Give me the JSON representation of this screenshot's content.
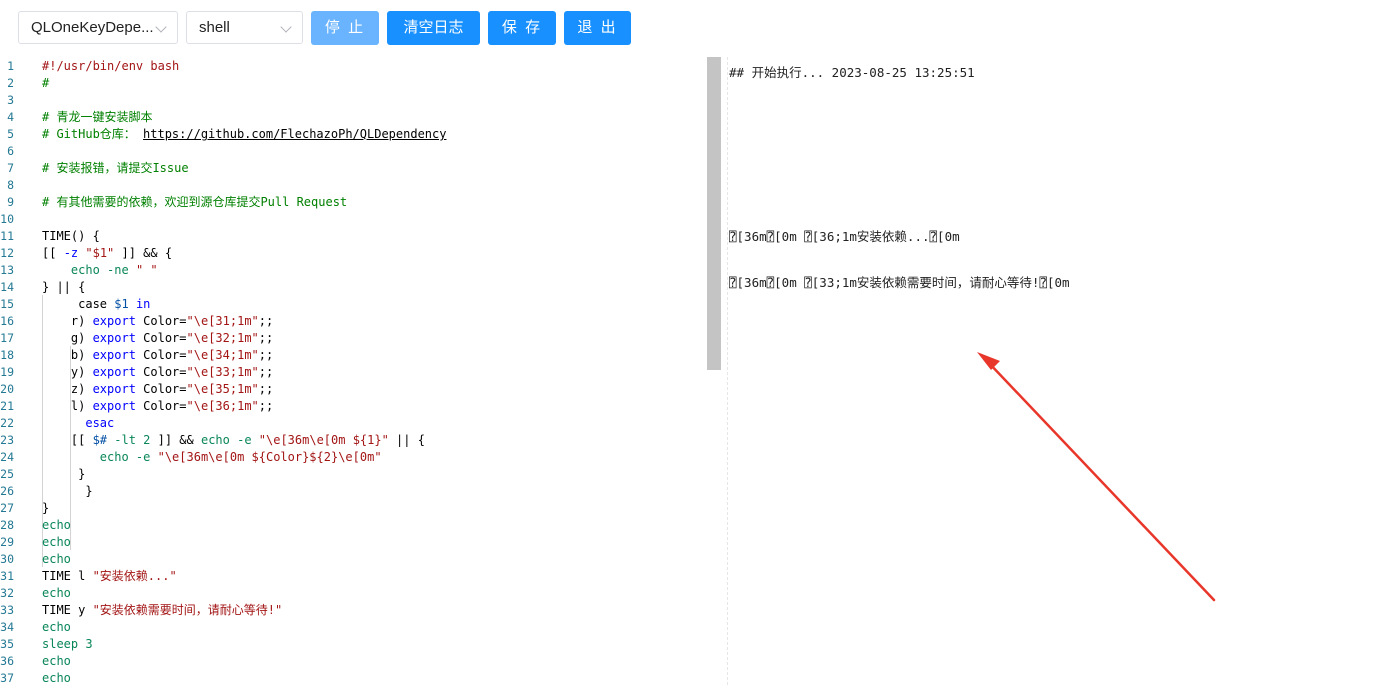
{
  "toolbar": {
    "script_select": "QLOneKeyDepe...",
    "lang_select": "shell",
    "stop_label": "停 止",
    "clear_label": "清空日志",
    "save_label": "保 存",
    "exit_label": "退 出"
  },
  "editor": {
    "lines": [
      {
        "n": "1",
        "parts": [
          {
            "t": "#!/usr/bin/env bash",
            "c": "c-str"
          }
        ]
      },
      {
        "n": "2",
        "parts": [
          {
            "t": "#",
            "c": "c-comment"
          }
        ]
      },
      {
        "n": "3",
        "parts": []
      },
      {
        "n": "4",
        "parts": [
          {
            "t": "# 青龙一键安装脚本",
            "c": "c-comment"
          }
        ]
      },
      {
        "n": "5",
        "parts": [
          {
            "t": "# GitHub仓库： ",
            "c": "c-comment"
          },
          {
            "t": "https://github.com/FlechazoPh/QLDependency",
            "c": "link"
          }
        ]
      },
      {
        "n": "6",
        "parts": []
      },
      {
        "n": "7",
        "parts": [
          {
            "t": "# 安装报错，请提交Issue",
            "c": "c-comment"
          }
        ]
      },
      {
        "n": "8",
        "parts": []
      },
      {
        "n": "9",
        "parts": [
          {
            "t": "# 有其他需要的依赖，欢迎到源仓库提交Pull Request",
            "c": "c-comment"
          }
        ]
      },
      {
        "n": "10",
        "parts": []
      },
      {
        "n": "11",
        "parts": [
          {
            "t": "TIME() {",
            "c": ""
          }
        ]
      },
      {
        "n": "12",
        "parts": [
          {
            "t": "[[ ",
            "c": ""
          },
          {
            "t": "-z ",
            "c": "c-kw"
          },
          {
            "t": "\"$1\"",
            "c": "c-str"
          },
          {
            "t": " ]] && {",
            "c": ""
          }
        ]
      },
      {
        "n": "13",
        "parts": [
          {
            "t": "    ",
            "c": ""
          },
          {
            "t": "echo -ne ",
            "c": "c-teal"
          },
          {
            "t": "\" \"",
            "c": "c-str"
          }
        ]
      },
      {
        "n": "14",
        "parts": [
          {
            "t": "} || {",
            "c": ""
          }
        ]
      },
      {
        "n": "15",
        "parts": [
          {
            "t": "     case ",
            "c": ""
          },
          {
            "t": "$1 ",
            "c": "c-var"
          },
          {
            "t": "in",
            "c": "c-kw"
          }
        ]
      },
      {
        "n": "16",
        "parts": [
          {
            "t": "    r) ",
            "c": ""
          },
          {
            "t": "export ",
            "c": "c-kw"
          },
          {
            "t": "Color=",
            "c": ""
          },
          {
            "t": "\"\\e[31;1m\"",
            "c": "c-str"
          },
          {
            "t": ";;",
            "c": ""
          }
        ]
      },
      {
        "n": "17",
        "parts": [
          {
            "t": "    g) ",
            "c": ""
          },
          {
            "t": "export ",
            "c": "c-kw"
          },
          {
            "t": "Color=",
            "c": ""
          },
          {
            "t": "\"\\e[32;1m\"",
            "c": "c-str"
          },
          {
            "t": ";;",
            "c": ""
          }
        ]
      },
      {
        "n": "18",
        "parts": [
          {
            "t": "    b) ",
            "c": ""
          },
          {
            "t": "export ",
            "c": "c-kw"
          },
          {
            "t": "Color=",
            "c": ""
          },
          {
            "t": "\"\\e[34;1m\"",
            "c": "c-str"
          },
          {
            "t": ";;",
            "c": ""
          }
        ]
      },
      {
        "n": "19",
        "parts": [
          {
            "t": "    y) ",
            "c": ""
          },
          {
            "t": "export ",
            "c": "c-kw"
          },
          {
            "t": "Color=",
            "c": ""
          },
          {
            "t": "\"\\e[33;1m\"",
            "c": "c-str"
          },
          {
            "t": ";;",
            "c": ""
          }
        ]
      },
      {
        "n": "20",
        "parts": [
          {
            "t": "    z) ",
            "c": ""
          },
          {
            "t": "export ",
            "c": "c-kw"
          },
          {
            "t": "Color=",
            "c": ""
          },
          {
            "t": "\"\\e[35;1m\"",
            "c": "c-str"
          },
          {
            "t": ";;",
            "c": ""
          }
        ]
      },
      {
        "n": "21",
        "parts": [
          {
            "t": "    l) ",
            "c": ""
          },
          {
            "t": "export ",
            "c": "c-kw"
          },
          {
            "t": "Color=",
            "c": ""
          },
          {
            "t": "\"\\e[36;1m\"",
            "c": "c-str"
          },
          {
            "t": ";;",
            "c": ""
          }
        ]
      },
      {
        "n": "22",
        "parts": [
          {
            "t": "      esac",
            "c": "c-kw"
          }
        ]
      },
      {
        "n": "23",
        "parts": [
          {
            "t": "    [[ ",
            "c": ""
          },
          {
            "t": "$# ",
            "c": "c-var"
          },
          {
            "t": "-lt 2 ",
            "c": "c-teal"
          },
          {
            "t": "]] && ",
            "c": ""
          },
          {
            "t": "echo -e ",
            "c": "c-teal"
          },
          {
            "t": "\"\\e[36m\\e[0m ${1}\"",
            "c": "c-str"
          },
          {
            "t": " || {",
            "c": ""
          }
        ]
      },
      {
        "n": "24",
        "parts": [
          {
            "t": "        ",
            "c": ""
          },
          {
            "t": "echo -e ",
            "c": "c-teal"
          },
          {
            "t": "\"\\e[36m\\e[0m ${Color}${2}\\e[0m\"",
            "c": "c-str"
          }
        ]
      },
      {
        "n": "25",
        "parts": [
          {
            "t": "     }",
            "c": ""
          }
        ]
      },
      {
        "n": "26",
        "parts": [
          {
            "t": "      }",
            "c": ""
          }
        ]
      },
      {
        "n": "27",
        "parts": [
          {
            "t": "}",
            "c": ""
          }
        ]
      },
      {
        "n": "28",
        "parts": [
          {
            "t": "echo",
            "c": "c-teal"
          }
        ]
      },
      {
        "n": "29",
        "parts": [
          {
            "t": "echo",
            "c": "c-teal"
          }
        ]
      },
      {
        "n": "30",
        "parts": [
          {
            "t": "echo",
            "c": "c-teal"
          }
        ]
      },
      {
        "n": "31",
        "parts": [
          {
            "t": "TIME l ",
            "c": ""
          },
          {
            "t": "\"安装依赖...\"",
            "c": "c-str"
          }
        ]
      },
      {
        "n": "32",
        "parts": [
          {
            "t": "echo",
            "c": "c-teal"
          }
        ]
      },
      {
        "n": "33",
        "parts": [
          {
            "t": "TIME y ",
            "c": ""
          },
          {
            "t": "\"安装依赖需要时间，请耐心等待!\"",
            "c": "c-str"
          }
        ]
      },
      {
        "n": "34",
        "parts": [
          {
            "t": "echo",
            "c": "c-teal"
          }
        ]
      },
      {
        "n": "35",
        "parts": [
          {
            "t": "sleep 3",
            "c": "c-teal"
          }
        ]
      },
      {
        "n": "36",
        "parts": [
          {
            "t": "echo",
            "c": "c-teal"
          }
        ]
      },
      {
        "n": "37",
        "parts": [
          {
            "t": "echo",
            "c": "c-teal"
          }
        ]
      }
    ]
  },
  "log": {
    "lines": [
      "## 开始执行... 2023-08-25 13:25:51",
      "⍰[36m⍰[0m ⍰[36;1m安装依赖...⍰[0m",
      "⍰[36m⍰[0m ⍰[33;1m安装依赖需要时间，请耐心等待!⍰[0m"
    ]
  },
  "colors": {
    "primary": "#1890ff",
    "primary_disabled": "#69b3ff",
    "annotation_arrow": "#e8362a"
  }
}
